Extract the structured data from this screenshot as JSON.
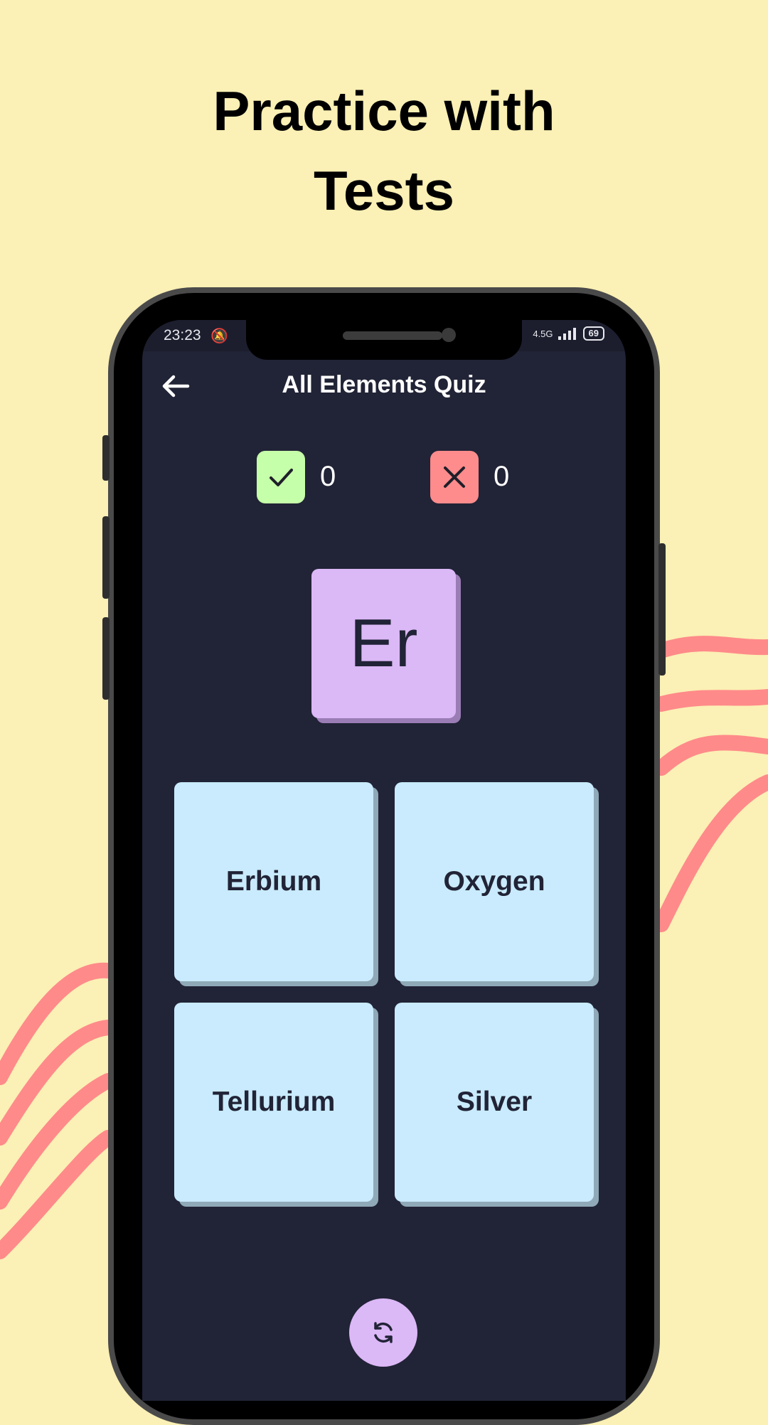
{
  "promo": {
    "headline_line1": "Practice with",
    "headline_line2": "Tests"
  },
  "status_bar": {
    "time": "23:23",
    "network": "4.5G",
    "battery": "69"
  },
  "app_bar": {
    "back_icon": "arrow-left-icon",
    "title": "All Elements Quiz"
  },
  "score": {
    "correct_icon": "check-icon",
    "correct_count": "0",
    "wrong_icon": "close-icon",
    "wrong_count": "0"
  },
  "question": {
    "symbol": "Er"
  },
  "answers": [
    {
      "label": "Erbium"
    },
    {
      "label": "Oxygen"
    },
    {
      "label": "Tellurium"
    },
    {
      "label": "Silver"
    }
  ],
  "actions": {
    "refresh_icon": "refresh-icon"
  },
  "colors": {
    "page_background": "#fbf0b5",
    "wave_accent": "#ff8a8a",
    "screen_background": "#212336",
    "correct_badge": "#c6ffa9",
    "wrong_badge": "#ff8c8c",
    "element_tile": "#dbb8f6",
    "answer_tile": "#c9ebfd"
  }
}
